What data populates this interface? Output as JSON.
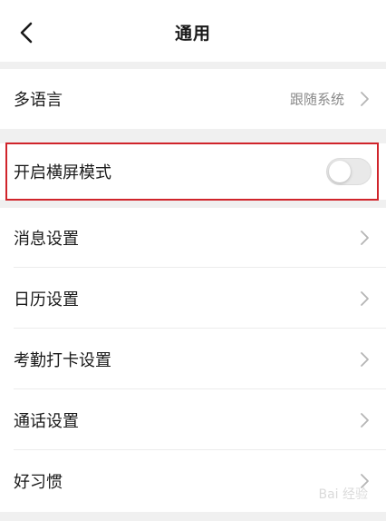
{
  "header": {
    "title": "通用",
    "back_icon": "chevron-left-icon"
  },
  "rows": [
    {
      "label": "多语言",
      "value": "跟随系统"
    },
    {
      "label": "开启横屏模式",
      "toggle_on": false
    },
    {
      "label": "消息设置"
    },
    {
      "label": "日历设置"
    },
    {
      "label": "考勤打卡设置"
    },
    {
      "label": "通话设置"
    },
    {
      "label": "好习惯"
    }
  ],
  "colors": {
    "highlight": "#d0242b",
    "toggle_off": "#e9e9e9"
  },
  "watermark": "Bai 经验"
}
